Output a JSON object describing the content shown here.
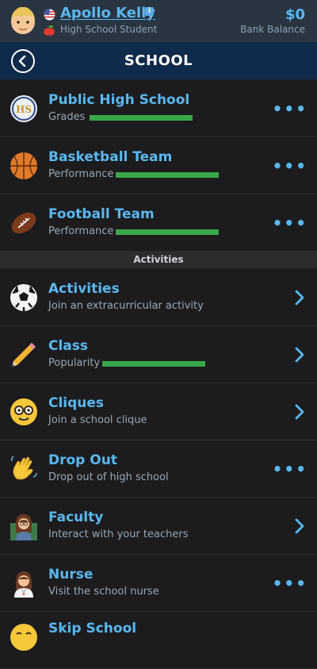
{
  "header": {
    "name": "Apollo Kelly",
    "subtitle": "High School Student",
    "balance": "$0",
    "balance_label": "Bank Balance",
    "info_badge": "i"
  },
  "titlebar": {
    "title": "SCHOOL"
  },
  "rows": [
    {
      "title": "Public High School",
      "subtitle": "Grades",
      "icon": "school-crest-icon",
      "action": "more",
      "progress": 0.9
    },
    {
      "title": "Basketball Team",
      "subtitle": "Performance",
      "icon": "basketball-icon",
      "action": "more",
      "progress": 0.95
    },
    {
      "title": "Football Team",
      "subtitle": "Performance",
      "icon": "football-icon",
      "action": "more",
      "progress": 0.95
    }
  ],
  "section_header": "Activities",
  "activities": [
    {
      "title": "Activities",
      "subtitle": "Join an extracurricular activity",
      "icon": "soccer-ball-icon",
      "action": "chevron"
    },
    {
      "title": "Class",
      "subtitle": "Popularity",
      "icon": "pencil-icon",
      "action": "chevron",
      "progress": 0.95
    },
    {
      "title": "Cliques",
      "subtitle": "Join a school clique",
      "icon": "nerd-face-icon",
      "action": "chevron"
    },
    {
      "title": "Drop Out",
      "subtitle": "Drop out of high school",
      "icon": "waving-hand-icon",
      "action": "more"
    },
    {
      "title": "Faculty",
      "subtitle": "Interact with your teachers",
      "icon": "teacher-icon",
      "action": "chevron"
    },
    {
      "title": "Nurse",
      "subtitle": "Visit the school nurse",
      "icon": "nurse-icon",
      "action": "more"
    },
    {
      "title": "Skip School",
      "subtitle": "",
      "icon": "sneaky-face-icon",
      "action": "more"
    }
  ],
  "more_glyph": "•••",
  "colors": {
    "accent": "#5ab8f0",
    "progress": "#3aa64a",
    "header_bg": "#2a3542",
    "titlebar_bg": "#0f2a4a"
  }
}
